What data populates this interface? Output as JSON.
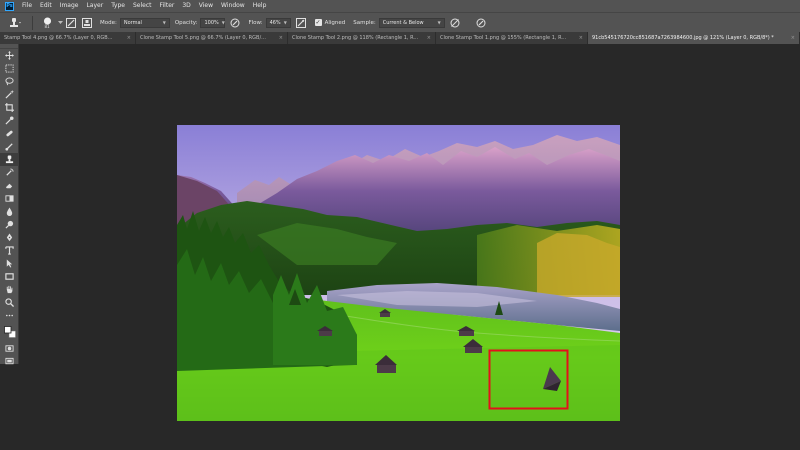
{
  "app": {
    "logo_text": "Ps"
  },
  "menu": [
    "File",
    "Edit",
    "Image",
    "Layer",
    "Type",
    "Select",
    "Filter",
    "3D",
    "View",
    "Window",
    "Help"
  ],
  "options": {
    "brush_size": "81",
    "mode_label": "Mode:",
    "mode_value": "Normal",
    "opacity_label": "Opacity:",
    "opacity_value": "100%",
    "flow_label": "Flow:",
    "flow_value": "46%",
    "aligned_label": "Aligned",
    "aligned_checked": true,
    "sample_label": "Sample:",
    "sample_value": "Current & Below"
  },
  "tabs": [
    {
      "label": "Stamp Tool 4.png @ 66.7% (Layer 0, RGB...",
      "active": false
    },
    {
      "label": "Clone Stamp Tool 5.png @ 66.7% (Layer 0, RGB/...",
      "active": false
    },
    {
      "label": "Clone Stamp Tool 2.png @ 118% (Rectangle 1, R...",
      "active": false
    },
    {
      "label": "Clone Stamp Tool 1.png @ 155% (Rectangle 1, R...",
      "active": false
    },
    {
      "label": "91cb545176720cc851687a7263984600.jpg @ 121% (Layer 0, RGB/8*) *",
      "active": true
    }
  ],
  "tab_close_glyph": "×",
  "tools": [
    "move-icon",
    "marquee-icon",
    "lasso-icon",
    "magic-wand-icon",
    "crop-icon",
    "eyedropper-icon",
    "healing-icon",
    "brush-icon",
    "clone-stamp-icon",
    "history-brush-icon",
    "eraser-icon",
    "gradient-icon",
    "blur-icon",
    "dodge-icon",
    "pen-icon",
    "type-icon",
    "path-select-icon",
    "rectangle-icon",
    "hand-icon",
    "zoom-icon",
    "edit-toolbar-icon",
    "color-swatches-icon",
    "quick-mask-icon",
    "screen-mode-icon"
  ],
  "colors": {
    "highlight_box": "#e3111b",
    "ui_dark": "#282828",
    "ui_panel": "#535353"
  }
}
